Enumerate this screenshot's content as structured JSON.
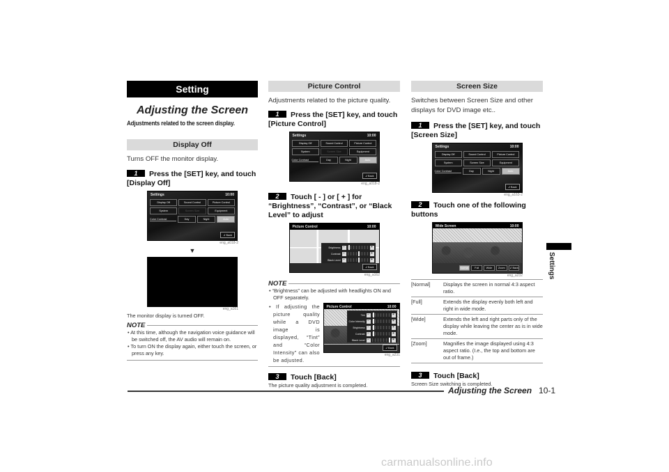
{
  "column1": {
    "chapter": "Setting",
    "page_title": "Adjusting the Screen",
    "lead": "Adjustments related to the screen display.",
    "section": "Display Off",
    "intro": "Turns OFF the monitor display.",
    "step1": {
      "num": "1",
      "text": "Press the [SET] key, and touch [Display Off]"
    },
    "fig1_caption": "eng_a018-2",
    "arrow": "▼",
    "fig2_caption": "eng_a161",
    "result": "The monitor display is turned OFF.",
    "note_label": "NOTE",
    "notes": [
      "At this time, although the navigation voice guidance will be switched off, the AV audio will remain on.",
      "To turn ON the display again, either touch the screen, or press any key."
    ]
  },
  "settings_screen": {
    "title": "Settings",
    "clock": "10:00",
    "row1": [
      "Display Off",
      "Sound Control",
      "Picture Control"
    ],
    "row2": [
      "System",
      "Screen Size",
      "Equipment"
    ],
    "color_contrast_label": "Color Contrast",
    "contrast_options": [
      "Day",
      "Night",
      "Auto"
    ],
    "back": "↲ Back"
  },
  "column2": {
    "section": "Picture Control",
    "intro": "Adjustments related to the picture quality.",
    "step1": {
      "num": "1",
      "text": "Press the [SET] key, and touch [Picture Control]"
    },
    "fig1_caption": "eng_a018-2",
    "step2": {
      "num": "2",
      "text": "Touch [ - ] or [ + ] for “Brightness”, “Contrast”, or “Black Level” to adjust"
    },
    "picture_screen": {
      "title": "Picture Control",
      "clock": "10:00",
      "sliders": [
        {
          "label": "Brightness",
          "level": 0.05
        },
        {
          "label": "Contrast",
          "level": 0.5
        },
        {
          "label": "Black Level",
          "level": 0.5
        }
      ],
      "minus": "−",
      "plus": "+",
      "back": "↲ Back"
    },
    "fig2_caption": "eng_a162",
    "note_label": "NOTE",
    "note1": "“Brightness” can be adjusted with headlights ON and OFF separately.",
    "note2": "If adjusting the picture quality while a DVD image is displayed, “Tint” and “Color Intensity” can also be adjusted.",
    "dvd_screen": {
      "title": "Picture Control",
      "clock": "10:00",
      "sliders": [
        {
          "label": "Tint",
          "level": 0.05
        },
        {
          "label": "Color Intensity",
          "level": 0.05
        },
        {
          "label": "Brightness",
          "level": 0.05
        },
        {
          "label": "Contrast",
          "level": 0.05
        },
        {
          "label": "Black Level",
          "level": 0.95
        }
      ],
      "back": "↲ Back"
    },
    "fig3_caption": "eng_a231",
    "step3": {
      "num": "3",
      "text": "Touch [Back]"
    },
    "result": "The picture quality adjustment is completed."
  },
  "column3": {
    "section": "Screen Size",
    "intro": "Switches between Screen Size and other displays for DVD image etc..",
    "step1": {
      "num": "1",
      "text": "Press the [SET] key, and touch [Screen Size]"
    },
    "fig1_caption": "eng_a163-2",
    "step2": {
      "num": "2",
      "text": "Touch one of the following buttons"
    },
    "wide_screen": {
      "title": "Wide Screen",
      "clock": "10:00",
      "buttons": [
        "Normal",
        "Full",
        "Wide",
        "Zoom",
        "↲ Back"
      ]
    },
    "fig2_caption": "eng_a232",
    "modes": [
      {
        "key": "[Normal]",
        "desc": "Displays the screen in normal 4:3 aspect ratio."
      },
      {
        "key": "[Full]",
        "desc": "Extends the display evenly both left and right in wide mode."
      },
      {
        "key": "[Wide]",
        "desc": "Extends the left and right parts only of the display while leaving the center as is in wide mode."
      },
      {
        "key": "[Zoom]",
        "desc": "Magnifies the image displayed using 4:3 aspect ratio. (I.e., the top and bottom are out of frame.)"
      }
    ],
    "step3": {
      "num": "3",
      "text": "Touch [Back]"
    },
    "result": "Screen Size switching is completed."
  },
  "side_tab": "Settings",
  "footer": {
    "title": "Adjusting the Screen",
    "page": "10-1"
  },
  "watermark": "carmanualsonline.info"
}
